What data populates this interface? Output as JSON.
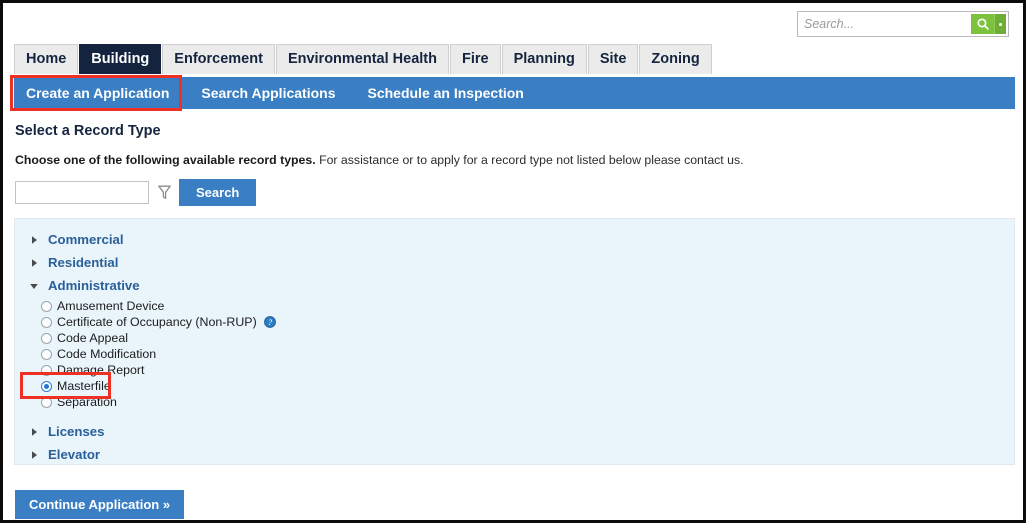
{
  "search": {
    "placeholder": "Search...",
    "value": "",
    "go_icon": "search-icon",
    "caret_icon": "dropdown-caret-icon",
    "accent_color": "#7ec13d"
  },
  "tabs": [
    {
      "label": "Home",
      "active": false
    },
    {
      "label": "Building",
      "active": true
    },
    {
      "label": "Enforcement",
      "active": false
    },
    {
      "label": "Environmental Health",
      "active": false
    },
    {
      "label": "Fire",
      "active": false
    },
    {
      "label": "Planning",
      "active": false
    },
    {
      "label": "Site",
      "active": false
    },
    {
      "label": "Zoning",
      "active": false
    }
  ],
  "subnav": {
    "background_color": "#3a7fc4",
    "items": [
      {
        "label": "Create an Application",
        "selected": true
      },
      {
        "label": "Search Applications",
        "selected": false
      },
      {
        "label": "Schedule an Inspection",
        "selected": false
      }
    ]
  },
  "content": {
    "page_title": "Select a Record Type",
    "intro_bold": "Choose one of the following available record types.",
    "intro_rest": " For assistance or to apply for a record type not listed below please contact us.",
    "filter": {
      "value": "",
      "funnel_icon": "filter-funnel-icon",
      "search_button": "Search"
    },
    "groups": [
      {
        "label": "Commercial",
        "expanded": false,
        "options": []
      },
      {
        "label": "Residential",
        "expanded": false,
        "options": []
      },
      {
        "label": "Administrative",
        "expanded": true,
        "options": [
          {
            "label": "Amusement Device",
            "selected": false,
            "help": false
          },
          {
            "label": "Certificate of Occupancy (Non-RUP)",
            "selected": false,
            "help": true
          },
          {
            "label": "Code Appeal",
            "selected": false,
            "help": false
          },
          {
            "label": "Code Modification",
            "selected": false,
            "help": false
          },
          {
            "label": "Damage Report",
            "selected": false,
            "help": false
          },
          {
            "label": "Masterfile",
            "selected": true,
            "help": false
          },
          {
            "label": "Separation",
            "selected": false,
            "help": false
          }
        ]
      },
      {
        "label": "Licenses",
        "expanded": false,
        "options": []
      },
      {
        "label": "Elevator",
        "expanded": false,
        "options": []
      }
    ],
    "continue_button": "Continue Application »",
    "panel_color": "#e9f4fb"
  },
  "annotations": {
    "highlight_color": "#ee3124",
    "boxes": [
      {
        "name": "create-an-application-highlight"
      },
      {
        "name": "masterfile-highlight"
      }
    ]
  }
}
